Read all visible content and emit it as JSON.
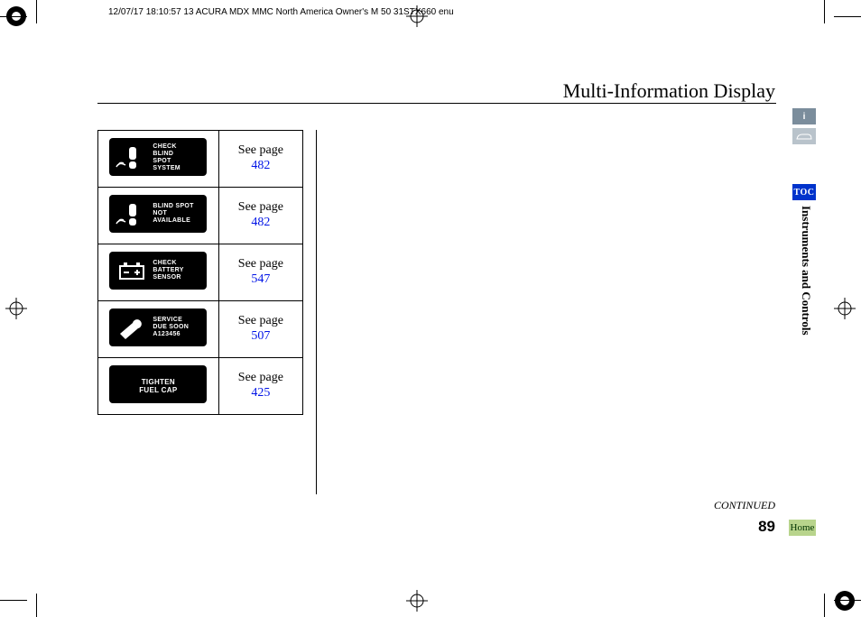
{
  "header": "12/07/17 18:10:57   13 ACURA MDX MMC North America Owner's M 50 31STX660 enu",
  "title": "Multi-Information Display",
  "see_page_prefix": "See page",
  "rows": [
    {
      "icon_lines": [
        "CHECK",
        "BLIND",
        "SPOT",
        "SYSTEM"
      ],
      "icon_type": "bsi",
      "page": "482"
    },
    {
      "icon_lines": [
        "BLIND SPOT",
        "NOT",
        "AVAILABLE"
      ],
      "icon_type": "bsi",
      "page": "482"
    },
    {
      "icon_lines": [
        "CHECK",
        "BATTERY",
        "SENSOR"
      ],
      "icon_type": "battery",
      "page": "547"
    },
    {
      "icon_lines": [
        "SERVICE",
        "DUE SOON",
        "A123456"
      ],
      "icon_type": "wrench",
      "page": "507"
    },
    {
      "icon_lines": [
        "TIGHTEN",
        "FUEL CAP"
      ],
      "icon_type": "none",
      "page": "425"
    }
  ],
  "continued": "CONTINUED",
  "page_number": "89",
  "tabs": {
    "info": "i",
    "vehicle": "⟟",
    "toc": "TOC",
    "home": "Home"
  },
  "section": "Instruments and Controls"
}
